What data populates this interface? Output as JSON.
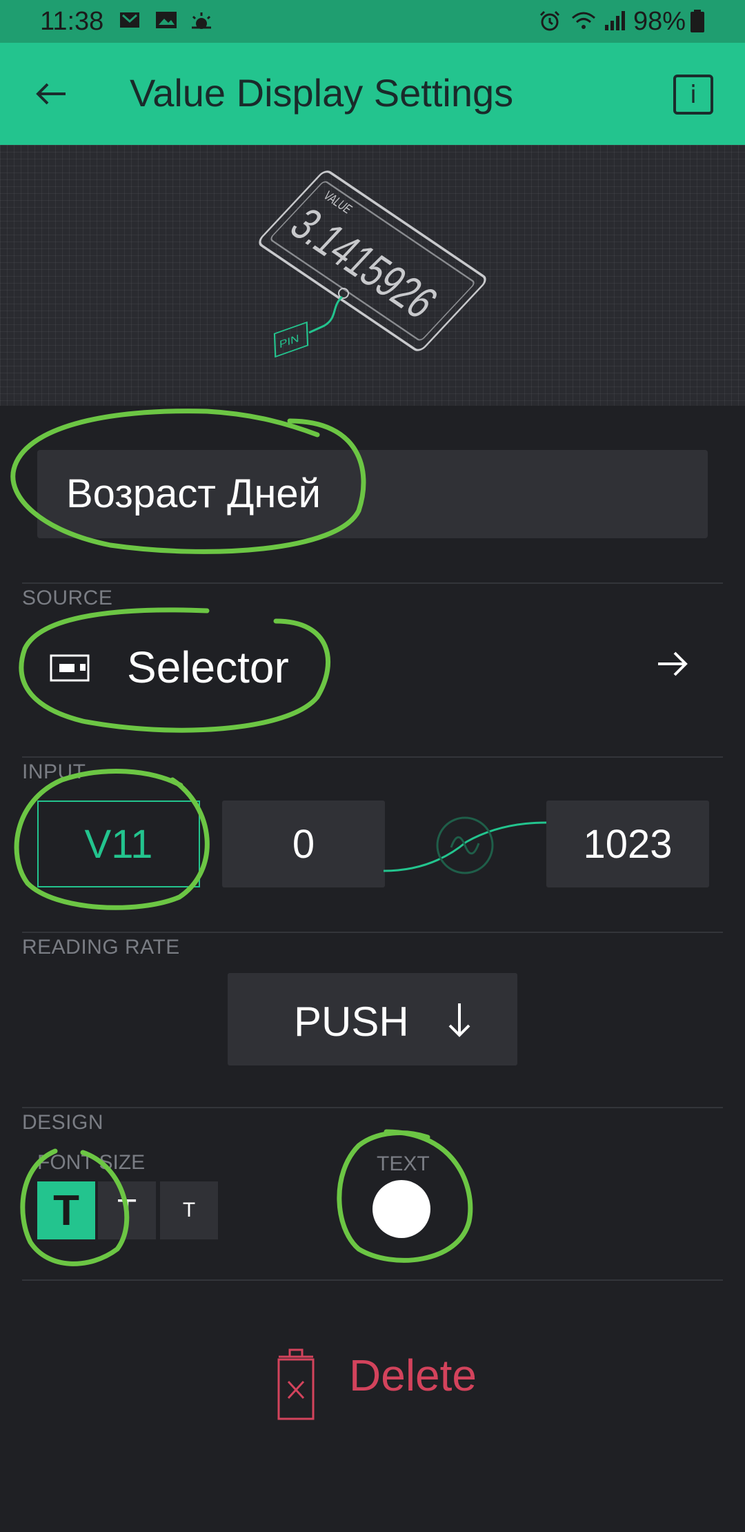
{
  "status_bar": {
    "time": "11:38",
    "battery": "98%"
  },
  "app_bar": {
    "title": "Value Display Settings",
    "info_label": "i"
  },
  "preview": {
    "value_caption": "VALUE",
    "value_text": "3.1415926",
    "pin_caption": "PIN"
  },
  "widget_name": "Возраст Дней",
  "source": {
    "section_label": "SOURCE",
    "device": "Selector"
  },
  "input": {
    "section_label": "INPUT",
    "pin": "V11",
    "min": "0",
    "max": "1023"
  },
  "reading_rate": {
    "section_label": "READING RATE",
    "value": "PUSH"
  },
  "design": {
    "section_label": "DESIGN",
    "font_size_label": "FONT SIZE",
    "font_sizes": [
      "T",
      "T",
      "T"
    ],
    "text_color_label": "TEXT",
    "text_color": "#ffffff"
  },
  "actions": {
    "delete_label": "Delete"
  },
  "colors": {
    "accent": "#23c48e",
    "danger": "#d3435c",
    "background": "#1f2024",
    "annotation": "#6cc644"
  }
}
